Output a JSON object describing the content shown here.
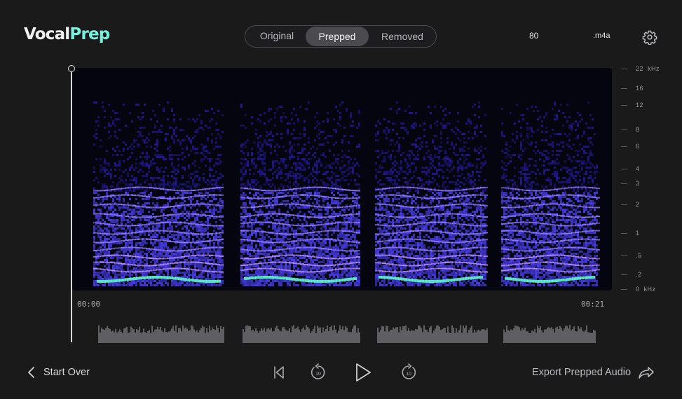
{
  "app": {
    "name_part1": "Vocal",
    "name_part2": "Prep"
  },
  "tabs": [
    {
      "label": "Original",
      "selected": false
    },
    {
      "label": "Prepped",
      "selected": true
    },
    {
      "label": "Removed",
      "selected": false
    }
  ],
  "header": {
    "value": "80",
    "format": ".m4a"
  },
  "frequency_axis": {
    "unit": "kHz",
    "labels": [
      "22",
      "16",
      "12",
      "8",
      "6",
      "4",
      "3",
      "2",
      "1",
      ".5",
      ".2",
      "0"
    ]
  },
  "timeline": {
    "start": "00:00",
    "end": "00:21"
  },
  "playhead": {
    "position": 0
  },
  "footer": {
    "start_over_label": "Start Over",
    "export_label": "Export Prepped Audio",
    "skip_seconds": "10"
  },
  "colors": {
    "accent": "#78f0dc",
    "spectrogram_low": "#3a2bd8",
    "spectrogram_high": "#58f0c8"
  },
  "icons": [
    "chevron-left-icon",
    "skip-back-icon",
    "rewind-10-icon",
    "play-icon",
    "forward-10-icon",
    "share-arrow-icon",
    "gear-icon"
  ]
}
